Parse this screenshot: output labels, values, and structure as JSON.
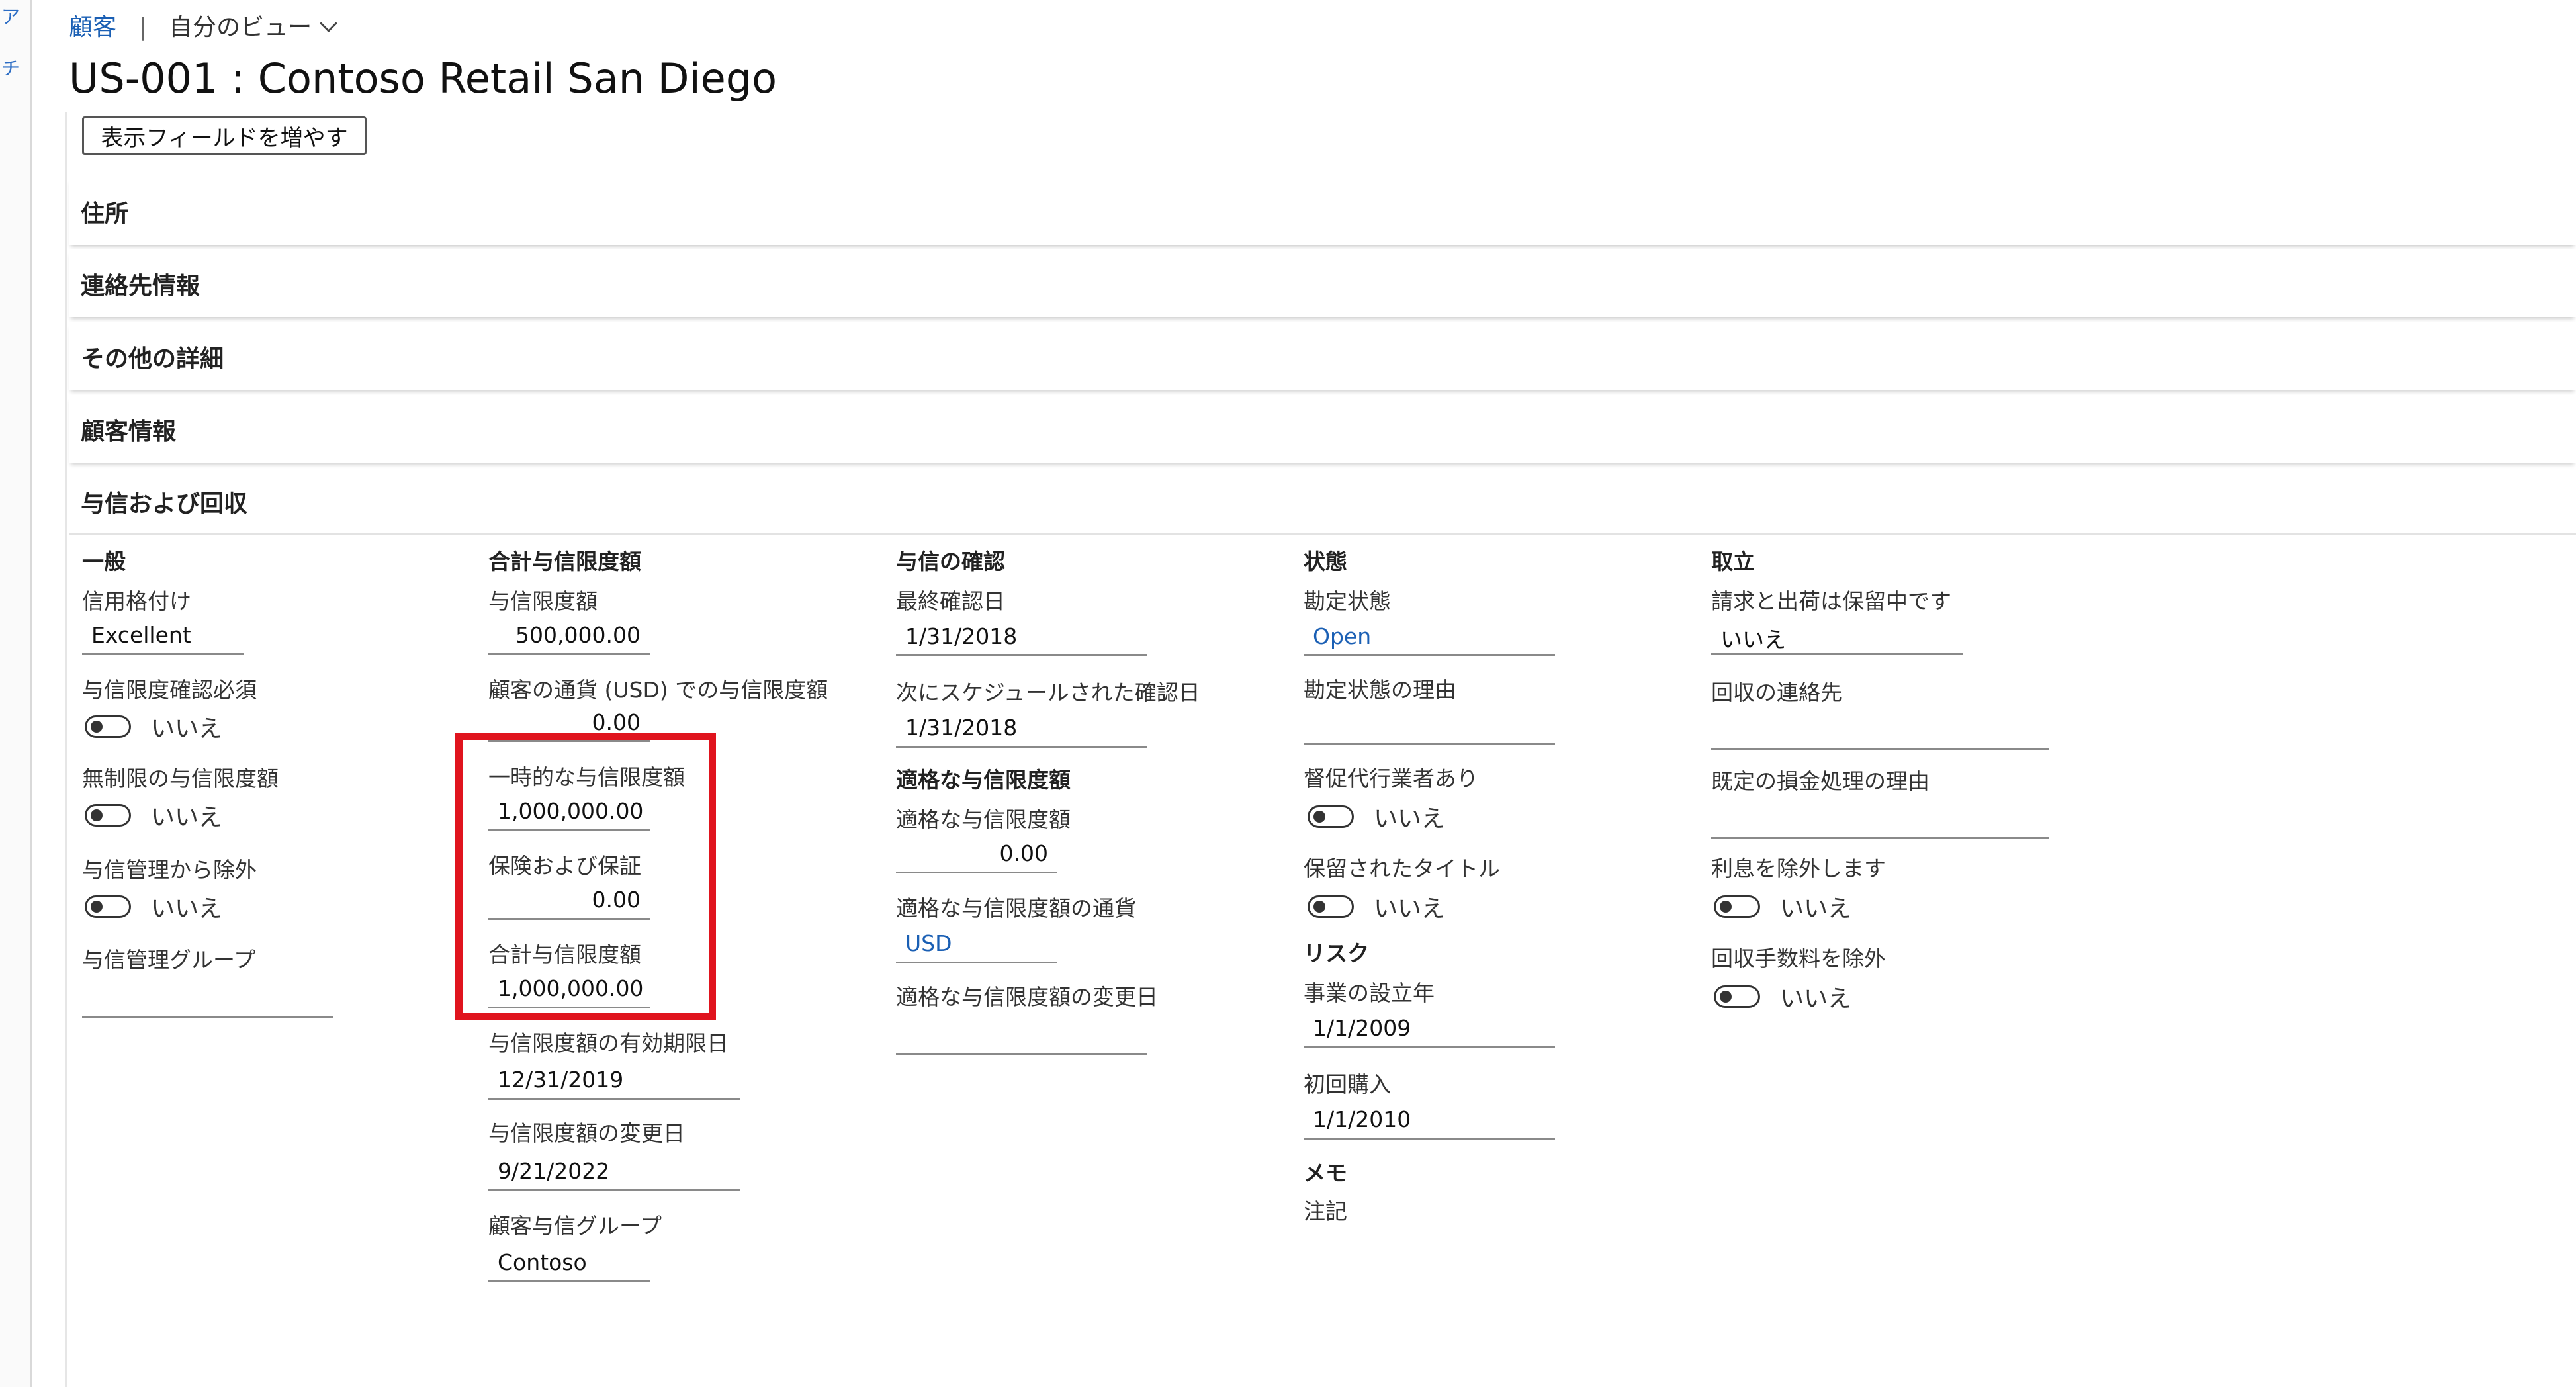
{
  "breadcrumb": {
    "module": "顧客",
    "separator": "|",
    "view": "自分のビュー"
  },
  "page_title": "US-001 : Contoso Retail San Diego",
  "show_more_button": "表示フィールドを増やす",
  "sections": [
    "住所",
    "連絡先情報",
    "その他の詳細",
    "顧客情報",
    "与信および回収"
  ],
  "left_nav_glyphs": [
    "ア",
    "チ"
  ],
  "toggle_off_label": "いいえ",
  "general": {
    "heading": "一般",
    "credit_rating_label": "信用格付け",
    "credit_rating_value": "Excellent",
    "mandatory_credit_limit_label": "与信限度確認必須",
    "unlimited_credit_label": "無制限の与信限度額",
    "exclude_credit_mgmt_label": "与信管理から除外",
    "credit_mgmt_group_label": "与信管理グループ",
    "credit_mgmt_group_value": ""
  },
  "total_credit": {
    "heading": "合計与信限度額",
    "credit_limit_label": "与信限度額",
    "credit_limit_value": "500,000.00",
    "limit_customer_currency_label": "顧客の通貨 (USD) での与信限度額",
    "limit_customer_currency_value": "0.00",
    "temporary_limit_label": "一時的な与信限度額",
    "temporary_limit_value": "1,000,000.00",
    "insurance_label": "保険および保証",
    "insurance_value": "0.00",
    "total_limit_label": "合計与信限度額",
    "total_limit_value": "1,000,000.00",
    "expiration_label": "与信限度額の有効期限日",
    "expiration_value": "12/31/2019",
    "change_date_label": "与信限度額の変更日",
    "change_date_value": "9/21/2022",
    "customer_credit_group_label": "顧客与信グループ",
    "customer_credit_group_value": "Contoso"
  },
  "credit_review": {
    "heading": "与信の確認",
    "last_review_label": "最終確認日",
    "last_review_value": "1/31/2018",
    "next_review_label": "次にスケジュールされた確認日",
    "next_review_value": "1/31/2018",
    "eligible_heading": "適格な与信限度額",
    "eligible_label": "適格な与信限度額",
    "eligible_value": "0.00",
    "eligible_currency_label": "適格な与信限度額の通貨",
    "eligible_currency_value": "USD",
    "eligible_change_label": "適格な与信限度額の変更日",
    "eligible_change_value": ""
  },
  "status": {
    "heading": "状態",
    "account_status_label": "勘定状態",
    "account_status_value": "Open",
    "account_status_reason_label": "勘定状態の理由",
    "account_status_reason_value": "",
    "collection_agency_label": "督促代行業者あり",
    "held_title_label": "保留されたタイトル",
    "risk_heading": "リスク",
    "year_established_label": "事業の設立年",
    "year_established_value": "1/1/2009",
    "first_purchase_label": "初回購入",
    "first_purchase_value": "1/1/2010",
    "memo_heading": "メモ",
    "note_label": "注記"
  },
  "collections": {
    "heading": "取立",
    "invoice_hold_label": "請求と出荷は保留中です",
    "invoice_hold_value": "いいえ",
    "collections_contact_label": "回収の連絡先",
    "collections_contact_value": "",
    "writeoff_reason_label": "既定の損金処理の理由",
    "writeoff_reason_value": "",
    "exclude_interest_label": "利息を除外します",
    "exclude_fee_label": "回収手数料を除外"
  }
}
